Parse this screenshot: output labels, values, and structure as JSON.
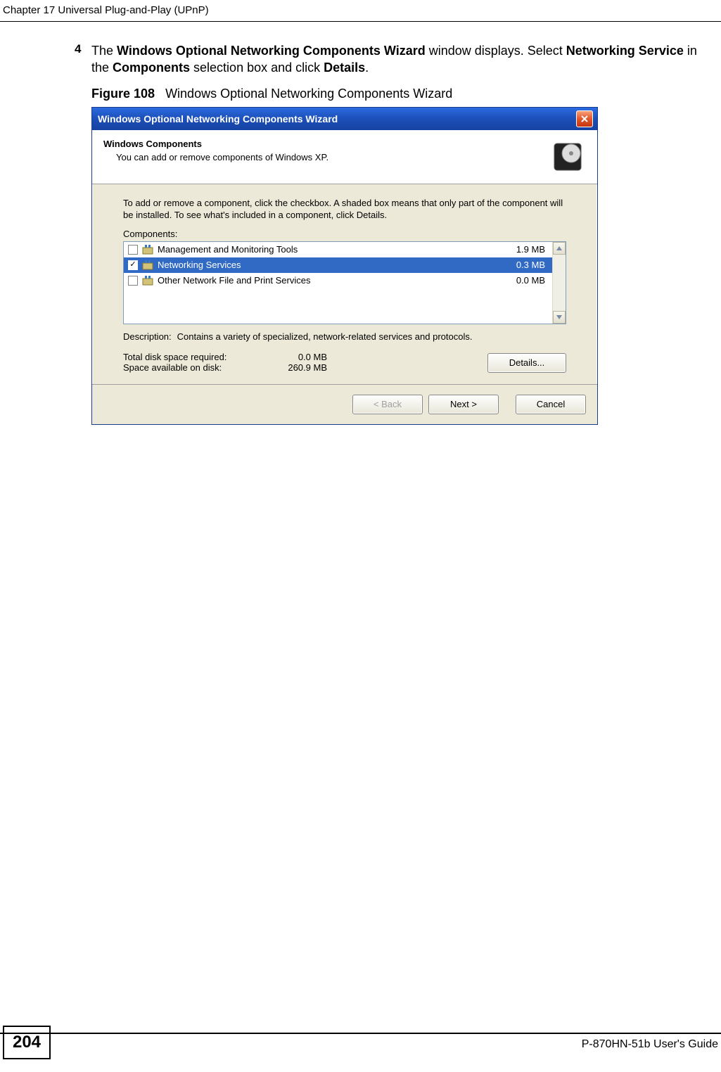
{
  "header": {
    "chapter": "Chapter 17 Universal Plug-and-Play (UPnP)"
  },
  "step": {
    "number": "4",
    "text_1": "The ",
    "text_2": "Windows Optional Networking Components Wizard",
    "text_3": " window displays. Select ",
    "text_4": "Networking Service",
    "text_5": " in the ",
    "text_6": "Components",
    "text_7": " selection box and click ",
    "text_8": "Details",
    "text_9": "."
  },
  "figure": {
    "label": "Figure 108",
    "caption": "Windows Optional Networking Components Wizard"
  },
  "wizard": {
    "title": "Windows Optional Networking Components Wizard",
    "head_title": "Windows Components",
    "head_sub": "You can add or remove components of Windows XP.",
    "instruction": "To add or remove a component, click the checkbox. A shaded box means that only part of the component will be installed. To see what's included in a component, click Details.",
    "components_label": "Components:",
    "components": [
      {
        "name": "Management and Monitoring Tools",
        "size": "1.9 MB",
        "checked": false,
        "selected": false
      },
      {
        "name": "Networking Services",
        "size": "0.3 MB",
        "checked": true,
        "selected": true
      },
      {
        "name": "Other Network File and Print Services",
        "size": "0.0 MB",
        "checked": false,
        "selected": false
      }
    ],
    "description_label": "Description:",
    "description_text": "Contains a variety of specialized, network-related services and protocols.",
    "space_required_label": "Total disk space required:",
    "space_required_value": "0.0 MB",
    "space_available_label": "Space available on disk:",
    "space_available_value": "260.9 MB",
    "details_button": "Details...",
    "back_button": "< Back",
    "next_button": "Next >",
    "cancel_button": "Cancel"
  },
  "footer": {
    "page": "204",
    "guide": "P-870HN-51b User's Guide"
  }
}
